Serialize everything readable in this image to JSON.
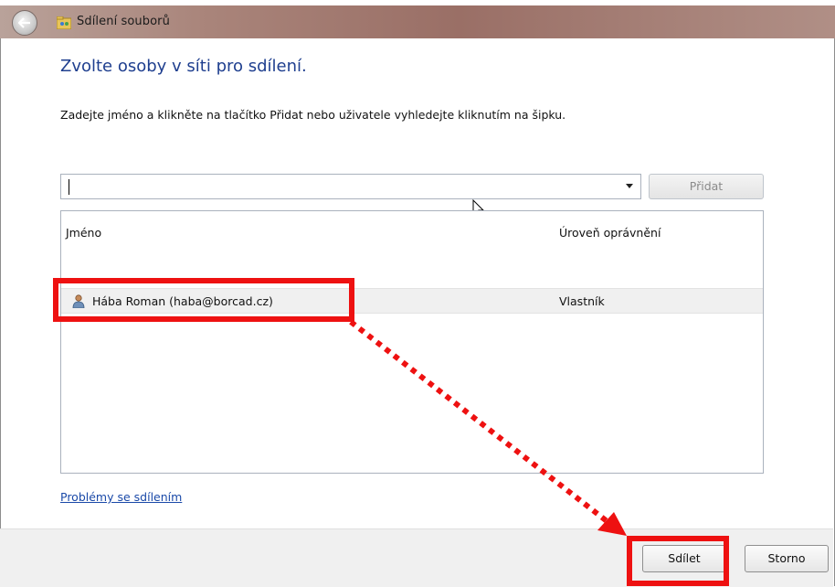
{
  "window": {
    "title": "Sdílení souborů"
  },
  "dialog": {
    "heading": "Zvolte osoby v síti pro sdílení.",
    "instruction": "Zadejte jméno a klikněte na tlačítko Přidat nebo uživatele vyhledejte kliknutím na šipku.",
    "name_input": {
      "value": "",
      "placeholder": ""
    },
    "add_button_label": "Přidat",
    "list": {
      "columns": [
        "Jméno",
        "Úroveň oprávnění"
      ],
      "rows": [
        {
          "name": "Hába Roman (haba@borcad.cz)",
          "permission": "Vlastník"
        }
      ]
    },
    "problems_link": "Problémy se sdílením",
    "share_button_label": "Sdílet",
    "cancel_button_label": "Storno"
  },
  "icons": {
    "back": "back-arrow-icon",
    "app": "share-folder-icon",
    "user": "user-icon",
    "dropdown": "chevron-down-icon",
    "cursor": "mouse-pointer-icon"
  },
  "colors": {
    "heading": "#1f3f8f",
    "link": "#1a49a8",
    "annotation": "#ee1111",
    "titlebar": "#a9847a"
  }
}
